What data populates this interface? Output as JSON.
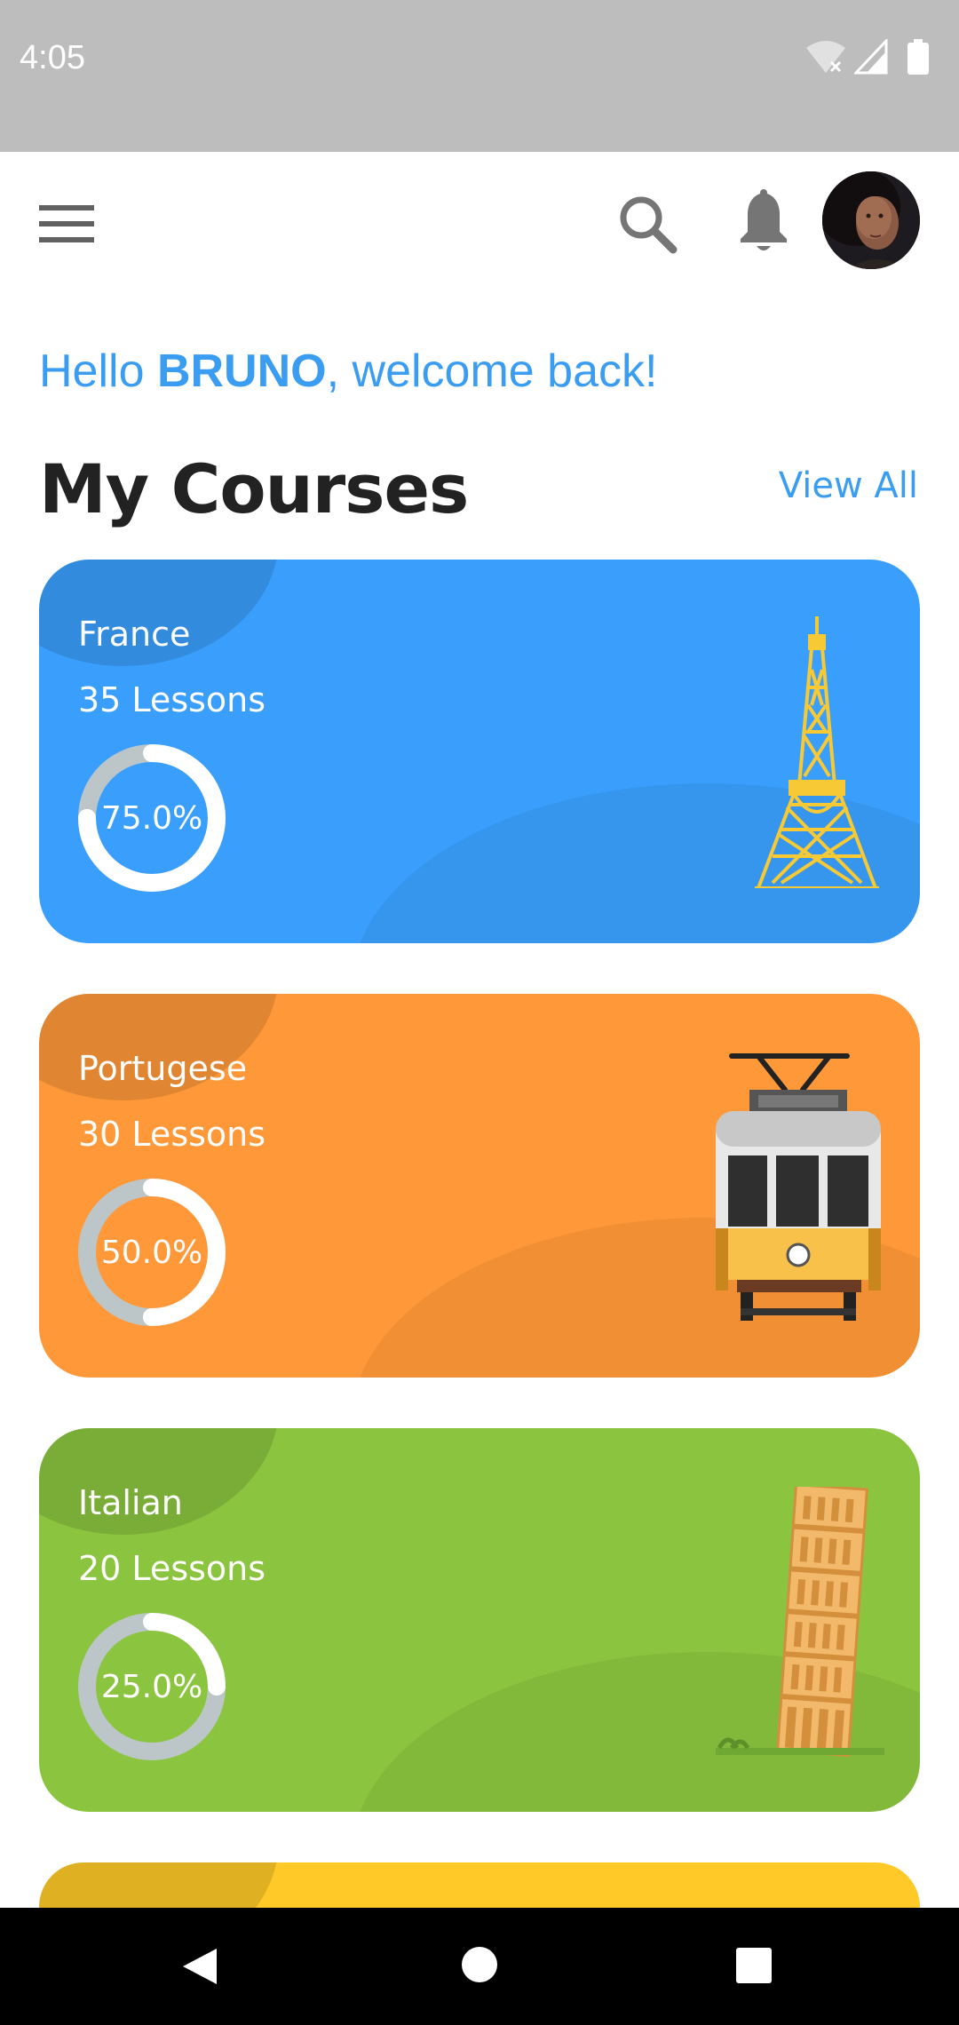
{
  "status_bar": {
    "time": "4:05"
  },
  "greeting": {
    "prefix": "Hello ",
    "name": "BRUNO",
    "suffix": ", welcome back!"
  },
  "section": {
    "title": "My Courses",
    "view_all": "View All"
  },
  "courses": [
    {
      "name": "France",
      "lessons": "35 Lessons",
      "progress_label": "75.0%",
      "progress": 0.75,
      "color": "#3a9ffc",
      "illustration": "eiffel-tower"
    },
    {
      "name": "Portugese",
      "lessons": "30 Lessons",
      "progress_label": "50.0%",
      "progress": 0.5,
      "color": "#ff9838",
      "illustration": "tram"
    },
    {
      "name": "Italian",
      "lessons": "20 Lessons",
      "progress_label": "25.0%",
      "progress": 0.25,
      "color": "#8bc53f",
      "illustration": "leaning-tower-of-pisa"
    },
    {
      "color": "#ffc928"
    }
  ],
  "colors": {
    "accent": "#3a9df2",
    "status_bar": "#bdbdbd",
    "ring_track": "#bcc6c9"
  }
}
